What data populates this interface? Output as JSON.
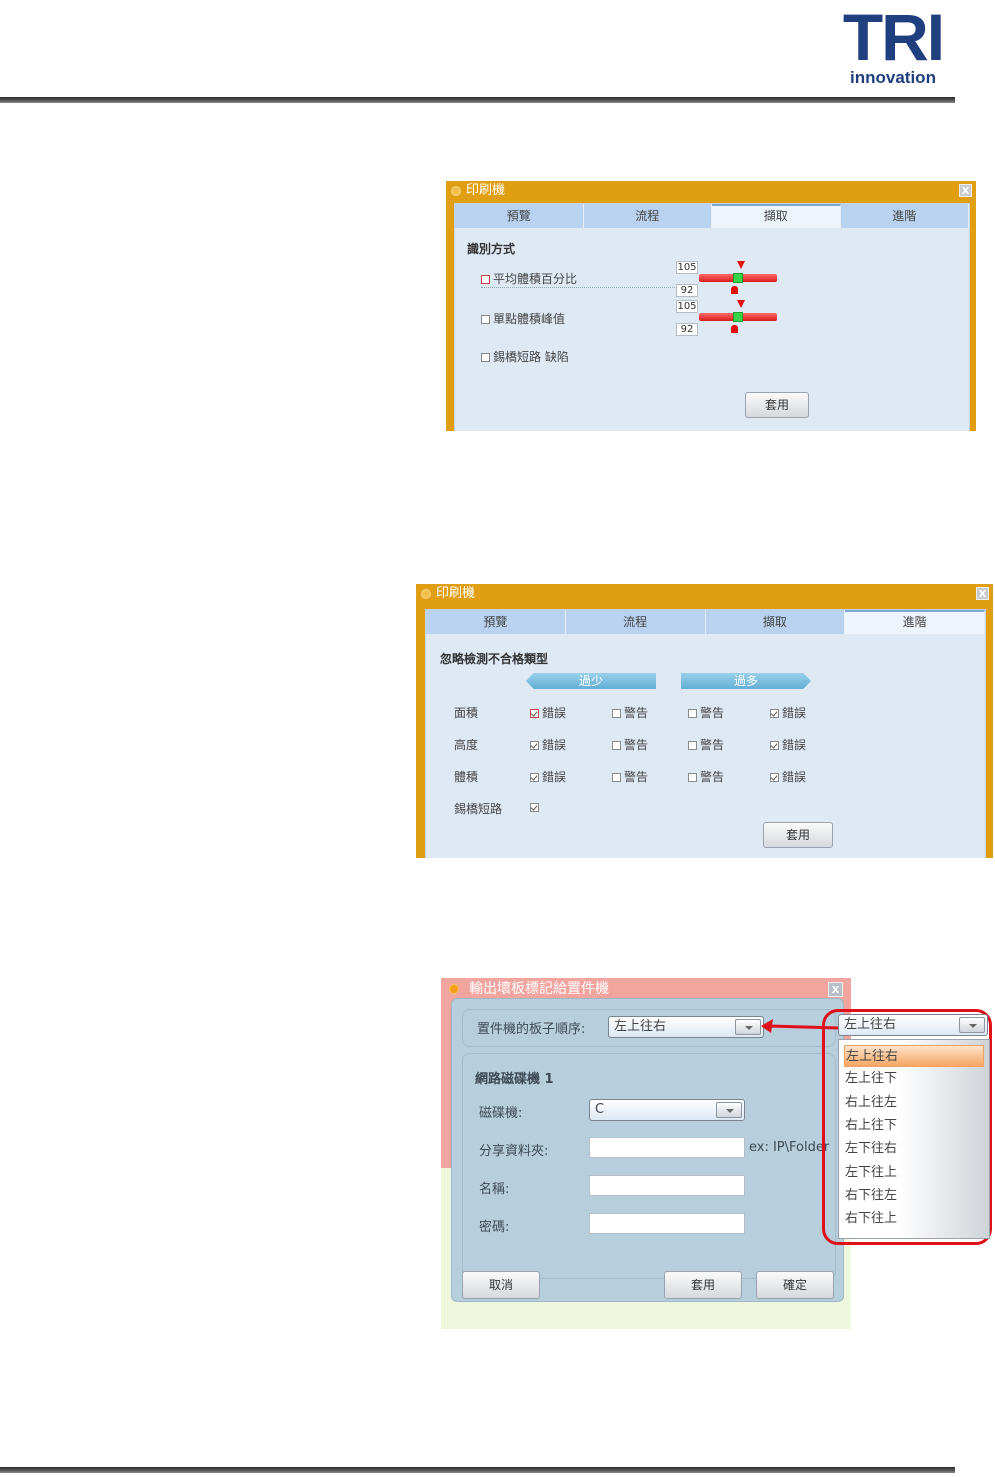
{
  "header": {
    "logo_letters": "TRI",
    "logo_sub": "innovation"
  },
  "colors": {
    "dialog_orange": "#e09e13",
    "rule": "#3a3a3a",
    "logo_blue": "#1f3f7f",
    "callout_red": "#e0101a"
  },
  "dialog1": {
    "title": "印刷機",
    "close": "X",
    "tabs": [
      "預覽",
      "流程",
      "擷取",
      "進階"
    ],
    "active_tab": "擷取",
    "section_title": "識別方式",
    "options": [
      {
        "label": "平均體積百分比",
        "checked": false,
        "slider_upper": "105",
        "slider_lower": "92"
      },
      {
        "label": "單點體積峰值",
        "checked": false,
        "slider_upper": "105",
        "slider_lower": "92"
      },
      {
        "label": "錫橋短路 缺陷",
        "checked": false
      }
    ],
    "apply_button": "套用"
  },
  "dialog2": {
    "title": "印刷機",
    "close": "X",
    "tabs": [
      "預覽",
      "流程",
      "擷取",
      "進階"
    ],
    "active_tab": "進階",
    "section_title": "忽略檢測不合格類型",
    "group_headers": [
      "過少",
      "過多"
    ],
    "rows": [
      {
        "label": "面積",
        "cells": [
          {
            "text": "錯誤",
            "checked": true
          },
          {
            "text": "警告",
            "checked": false
          },
          {
            "text": "警告",
            "checked": false
          },
          {
            "text": "錯誤",
            "checked": true
          }
        ]
      },
      {
        "label": "高度",
        "cells": [
          {
            "text": "錯誤",
            "checked": true
          },
          {
            "text": "警告",
            "checked": false
          },
          {
            "text": "警告",
            "checked": false
          },
          {
            "text": "錯誤",
            "checked": true
          }
        ]
      },
      {
        "label": "體積",
        "cells": [
          {
            "text": "錯誤",
            "checked": true
          },
          {
            "text": "警告",
            "checked": false
          },
          {
            "text": "警告",
            "checked": false
          },
          {
            "text": "錯誤",
            "checked": true
          }
        ]
      },
      {
        "label": "錫橋短路",
        "checked": true
      }
    ],
    "apply_button": "套用"
  },
  "dialog3": {
    "title": "輸出壞板標記給置件機",
    "close": "X",
    "order_label": "置件機的板子順序:",
    "order_value": "左上往右",
    "network_title": "網路磁碟機 1",
    "drive_label": "磁碟機:",
    "drive_value": "C",
    "share_label": "分享資料夾:",
    "share_hint": "ex: IP\\Folder",
    "name_label": "名稱:",
    "password_label": "密碼:",
    "cancel_button": "取消",
    "apply_button": "套用",
    "ok_button": "確定"
  },
  "dropdown": {
    "value": "左上往右",
    "options": [
      "左上往右",
      "左上往下",
      "右上往左",
      "右上往下",
      "左下往右",
      "左下往上",
      "右下往左",
      "右下往上"
    ],
    "selected": "左上往右"
  }
}
